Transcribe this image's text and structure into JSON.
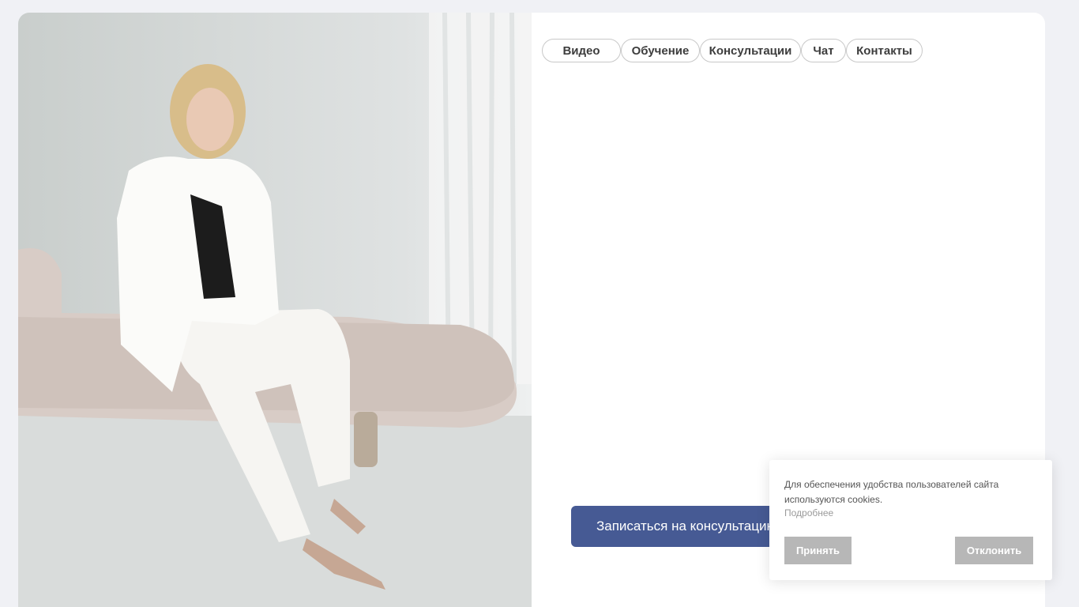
{
  "nav": {
    "tabs": [
      {
        "label": "Видео"
      },
      {
        "label": "Обучение"
      },
      {
        "label": "Консультации"
      },
      {
        "label": "Чат"
      },
      {
        "label": "Контакты"
      }
    ]
  },
  "hero": {
    "photo_subject": "woman-in-white-suit-on-sofa",
    "cta_label": "Записаться на консультацию"
  },
  "cookie_banner": {
    "text": "Для обеспечения удобства пользователей сайта используются cookies.",
    "more_link": "Подробнее",
    "accept_label": "Принять",
    "decline_label": "Отклонить"
  },
  "colors": {
    "page_bg": "#f0f1f5",
    "cta_bg": "#465a94",
    "cookie_btn_bg": "#b7b7b7"
  }
}
